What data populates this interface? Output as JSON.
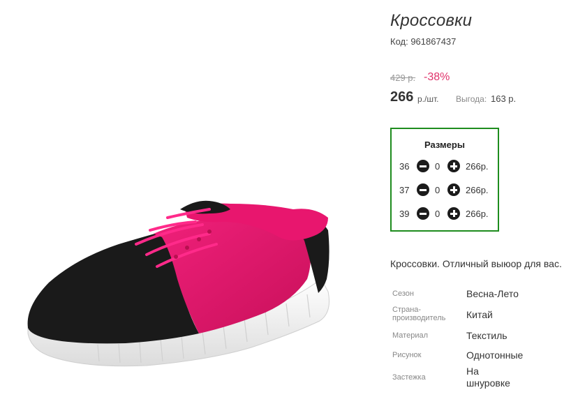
{
  "product": {
    "title": "Кроссовки",
    "code": "Код: 961867437",
    "old_price": "429 р.",
    "discount": "-38%",
    "price": "266",
    "price_unit": "р./шт.",
    "benefit_label": "Выгода:",
    "benefit_value": "163 р.",
    "image_icon": "sneaker-product-image"
  },
  "sizes": {
    "title": "Размеры",
    "rows": [
      {
        "size": "36",
        "qty": "0",
        "price": "266р."
      },
      {
        "size": "37",
        "qty": "0",
        "price": "266р."
      },
      {
        "size": "39",
        "qty": "0",
        "price": "266р."
      }
    ],
    "border_color": "#1e8c1e"
  },
  "description": "Кроссовки. Отличный выюор для вас.",
  "attributes": [
    {
      "label": "Сезон",
      "value": "Весна-Лето"
    },
    {
      "label": "Страна-производитель",
      "value": "Китай"
    },
    {
      "label": "Материал",
      "value": "Текстиль"
    },
    {
      "label": "Рисунок",
      "value": "Однотонные"
    },
    {
      "label": "Застежка",
      "value": "На шнуровке"
    }
  ],
  "colors": {
    "discount": "#e0336b",
    "shoe_pink": "#e8166e",
    "shoe_black": "#1a1a1a"
  }
}
